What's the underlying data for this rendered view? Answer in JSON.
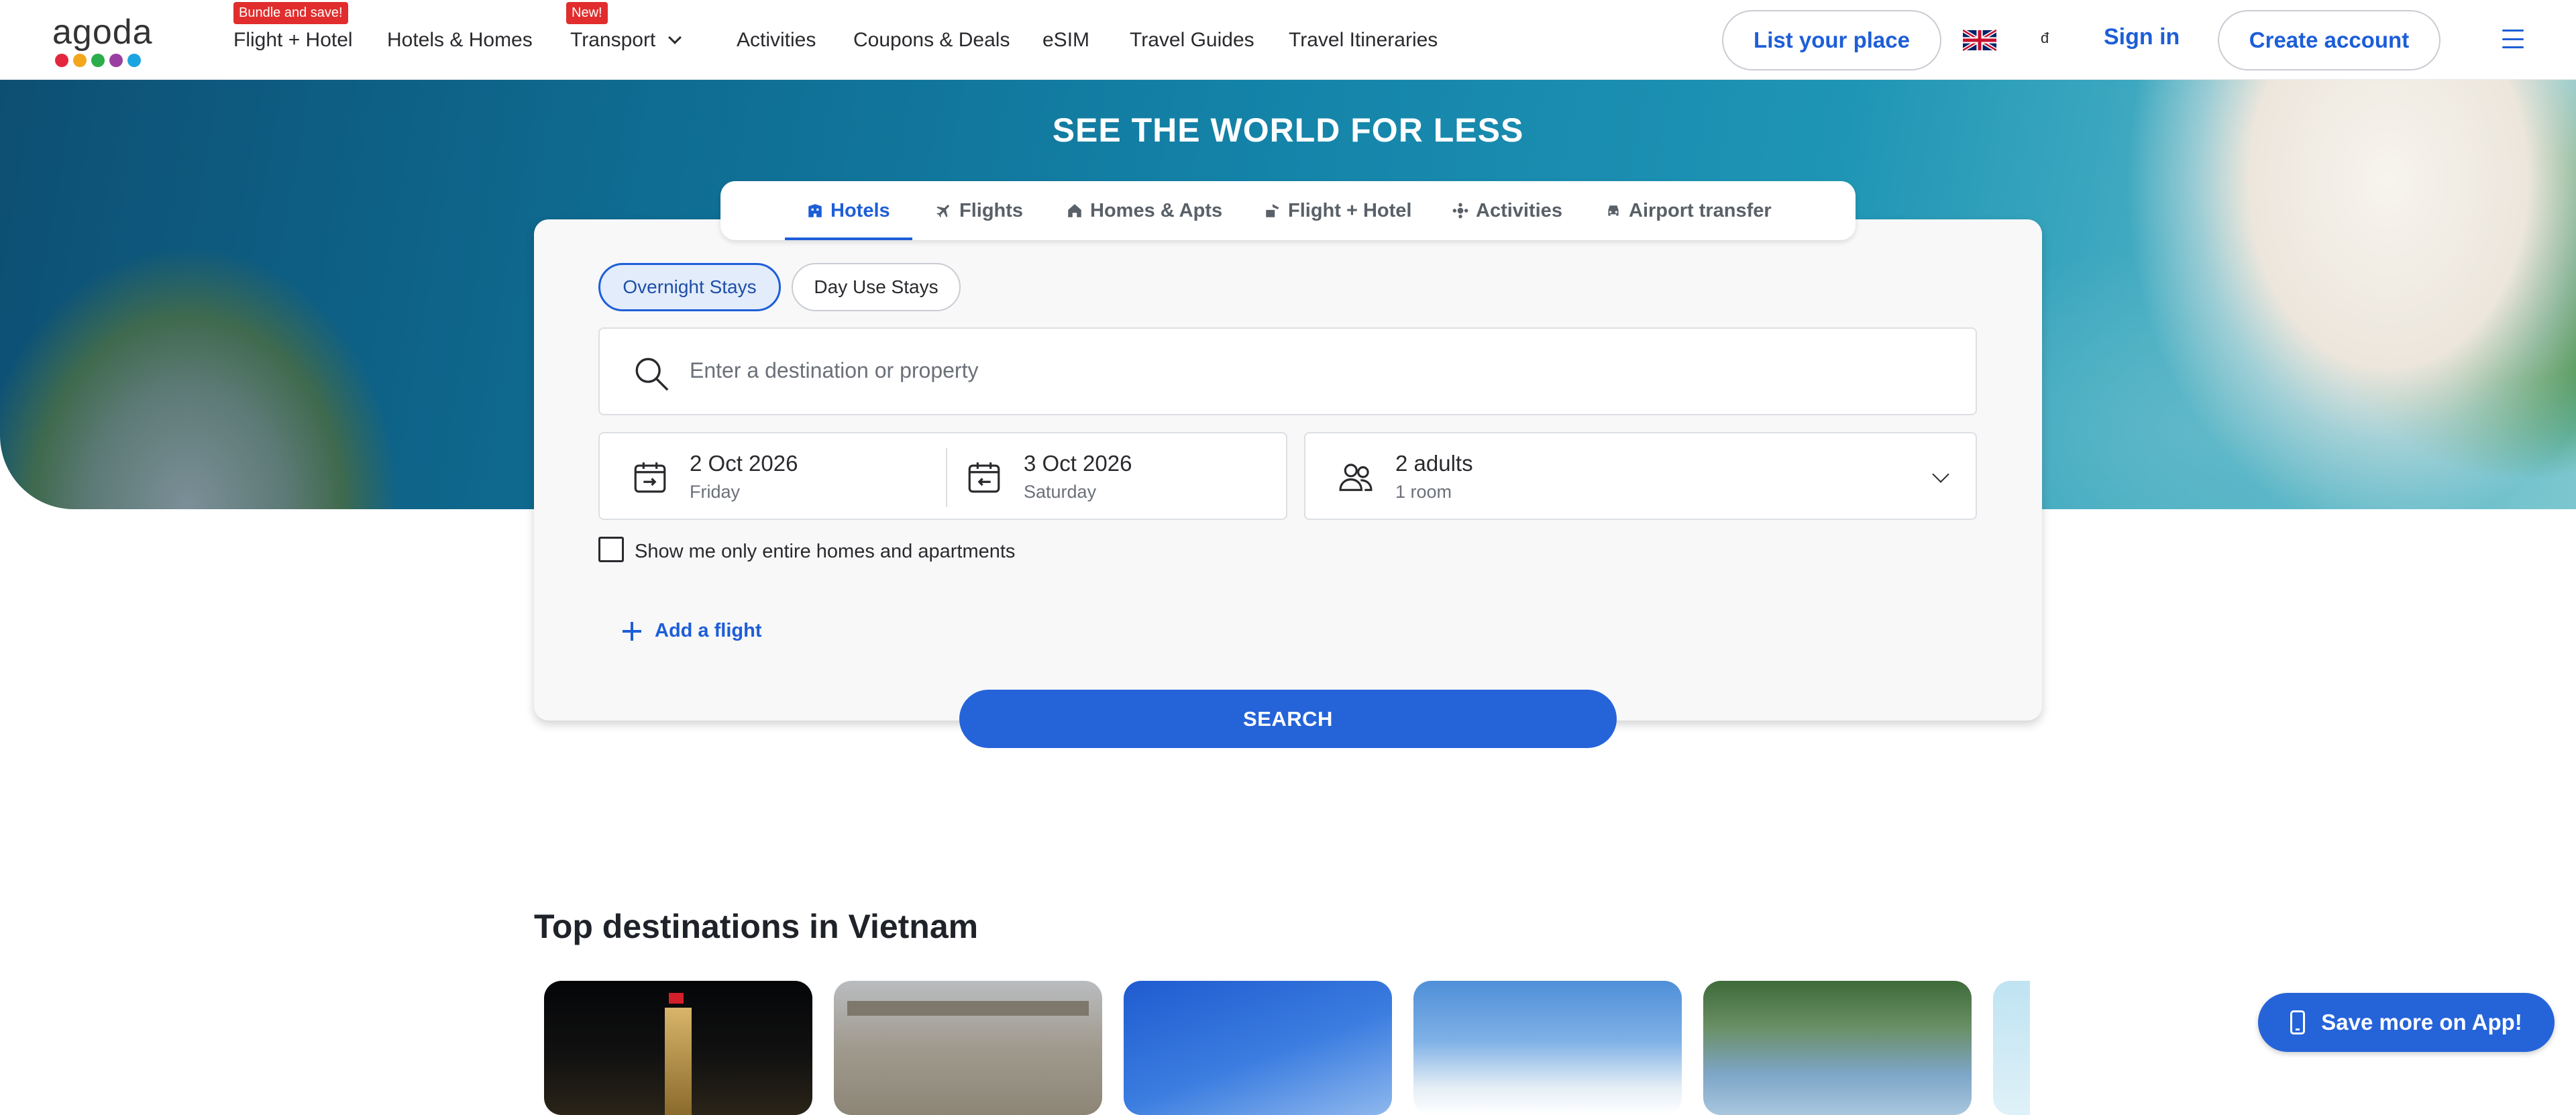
{
  "header": {
    "logo_text": "agoda",
    "logo_dot_colors": [
      "#e3283d",
      "#f3a71c",
      "#2cad4b",
      "#9a3ea0",
      "#1ba5e0"
    ],
    "nav": [
      {
        "label": "Flight + Hotel",
        "badge": "Bundle and save!"
      },
      {
        "label": "Hotels & Homes"
      },
      {
        "label": "Transport",
        "badge": "New!",
        "has_dropdown": true
      },
      {
        "label": "Activities"
      },
      {
        "label": "Coupons & Deals"
      },
      {
        "label": "eSIM"
      },
      {
        "label": "Travel Guides"
      },
      {
        "label": "Travel Itineraries"
      }
    ],
    "list_place_label": "List your place",
    "language_flag": "uk-flag-icon",
    "currency_symbol": "đ",
    "signin_label": "Sign in",
    "create_account_label": "Create account",
    "menu_icon": "hamburger-icon"
  },
  "hero": {
    "title": "SEE THE WORLD FOR LESS"
  },
  "search": {
    "tabs": [
      {
        "label": "Hotels",
        "icon": "hotel-icon",
        "active": true
      },
      {
        "label": "Flights",
        "icon": "plane-icon"
      },
      {
        "label": "Homes & Apts",
        "icon": "home-icon"
      },
      {
        "label": "Flight + Hotel",
        "icon": "flight-hotel-icon"
      },
      {
        "label": "Activities",
        "icon": "activities-icon"
      },
      {
        "label": "Airport transfer",
        "icon": "car-icon"
      }
    ],
    "stay_types": [
      "Overnight Stays",
      "Day Use Stays"
    ],
    "destination_placeholder": "Enter a destination or property",
    "checkin": {
      "date": "2 Oct 2026",
      "day": "Friday"
    },
    "checkout": {
      "date": "3 Oct 2026",
      "day": "Saturday"
    },
    "guests": {
      "main": "2 adults",
      "sub": "1 room"
    },
    "entire_homes_label": "Show me only entire homes and apartments",
    "entire_homes_checked": false,
    "add_flight_label": "Add a flight",
    "search_label": "SEARCH"
  },
  "destinations": {
    "title": "Top destinations in Vietnam"
  },
  "app_promo": {
    "label": "Save more on App!"
  },
  "colors": {
    "brand_blue": "#2563d9",
    "badge_red": "#e12d2d"
  }
}
